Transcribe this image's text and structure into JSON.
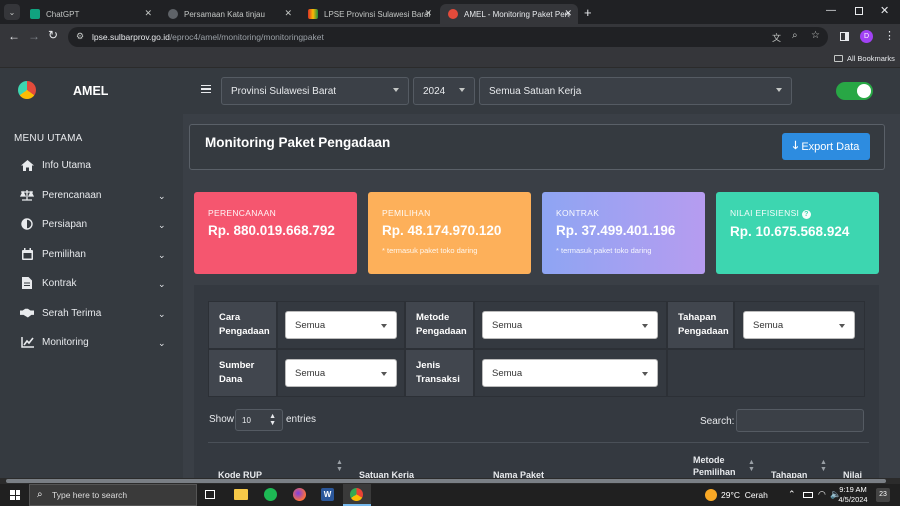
{
  "browser": {
    "tabs": [
      {
        "title": "ChatGPT",
        "favicon_color": "#10a37f"
      },
      {
        "title": "Persamaan Kata tinjau",
        "favicon_color": "#e8eaed"
      },
      {
        "title": "LPSE Provinsi Sulawesi Barat - L",
        "favicon_color": "#d93025"
      },
      {
        "title": "AMEL - Monitoring Paket Pengad",
        "favicon_color": "#e34b3b"
      }
    ],
    "url_host": "lpse.sulbarprov.go.id",
    "url_path": "/eproc4/amel/monitoring/monitoringpaket",
    "profile_initial": "D",
    "bookmarks_label": "All Bookmarks"
  },
  "app": {
    "brand": "AMEL",
    "header": {
      "province": "Provinsi Sulawesi Barat",
      "year": "2024",
      "work_unit": "Semua Satuan Kerja",
      "toggle_on": true
    },
    "sidebar": {
      "heading": "MENU UTAMA",
      "items": [
        {
          "label": "Info Utama",
          "icon": "home-icon",
          "expandable": false
        },
        {
          "label": "Perencanaan",
          "icon": "scale-icon",
          "expandable": true
        },
        {
          "label": "Persiapan",
          "icon": "half-circle-icon",
          "expandable": true
        },
        {
          "label": "Pemilihan",
          "icon": "calendar-icon",
          "expandable": true
        },
        {
          "label": "Kontrak",
          "icon": "file-icon",
          "expandable": true
        },
        {
          "label": "Serah Terima",
          "icon": "handshake-icon",
          "expandable": true
        },
        {
          "label": "Monitoring",
          "icon": "chart-line-icon",
          "expandable": true
        }
      ]
    },
    "page": {
      "title": "Monitoring Paket Pengadaan",
      "export_label": "Export Data"
    },
    "cards": [
      {
        "label": "PERENCANAAN",
        "value": "Rp. 880.019.668.792",
        "note": "",
        "color": "#f5566f"
      },
      {
        "label": "PEMILIHAN",
        "value": "Rp. 48.174.970.120",
        "note": "* termasuk paket toko daring",
        "color": "#fdb05a"
      },
      {
        "label": "KONTRAK",
        "value": "Rp. 37.499.401.196",
        "note": "* termasuk paket toko daring",
        "color": "#9a9ff0"
      },
      {
        "label": "NILAI EFISIENSI",
        "value": "Rp. 10.675.568.924",
        "note": "",
        "color": "#3dd6b0"
      }
    ],
    "filters": {
      "cara_pengadaan": {
        "label_1": "Cara",
        "label_2": "Pengadaan",
        "value": "Semua"
      },
      "metode_pengadaan": {
        "label_1": "Metode",
        "label_2": "Pengadaan",
        "value": "Semua"
      },
      "tahapan_pengadaan": {
        "label_1": "Tahapan",
        "label_2": "Pengadaan",
        "value": "Semua"
      },
      "sumber_dana": {
        "label_1": "Sumber",
        "label_2": "Dana",
        "value": "Semua"
      },
      "jenis_transaksi": {
        "label_1": "Jenis",
        "label_2": "Transaksi",
        "value": "Semua"
      }
    },
    "table_controls": {
      "show_label": "Show",
      "entries_value": "10",
      "entries_label": "entries",
      "search_label": "Search:"
    },
    "table_headers": [
      "Kode RUP",
      "Satuan Kerja",
      "Nama Paket",
      "Metode Pemilihan",
      "Tahapan",
      "Nilai E"
    ]
  },
  "taskbar": {
    "search_placeholder": "Type here to search",
    "weather": "29°C  Cerah",
    "time": "9:19 AM",
    "date": "4/5/2024",
    "notification_count": "23"
  }
}
